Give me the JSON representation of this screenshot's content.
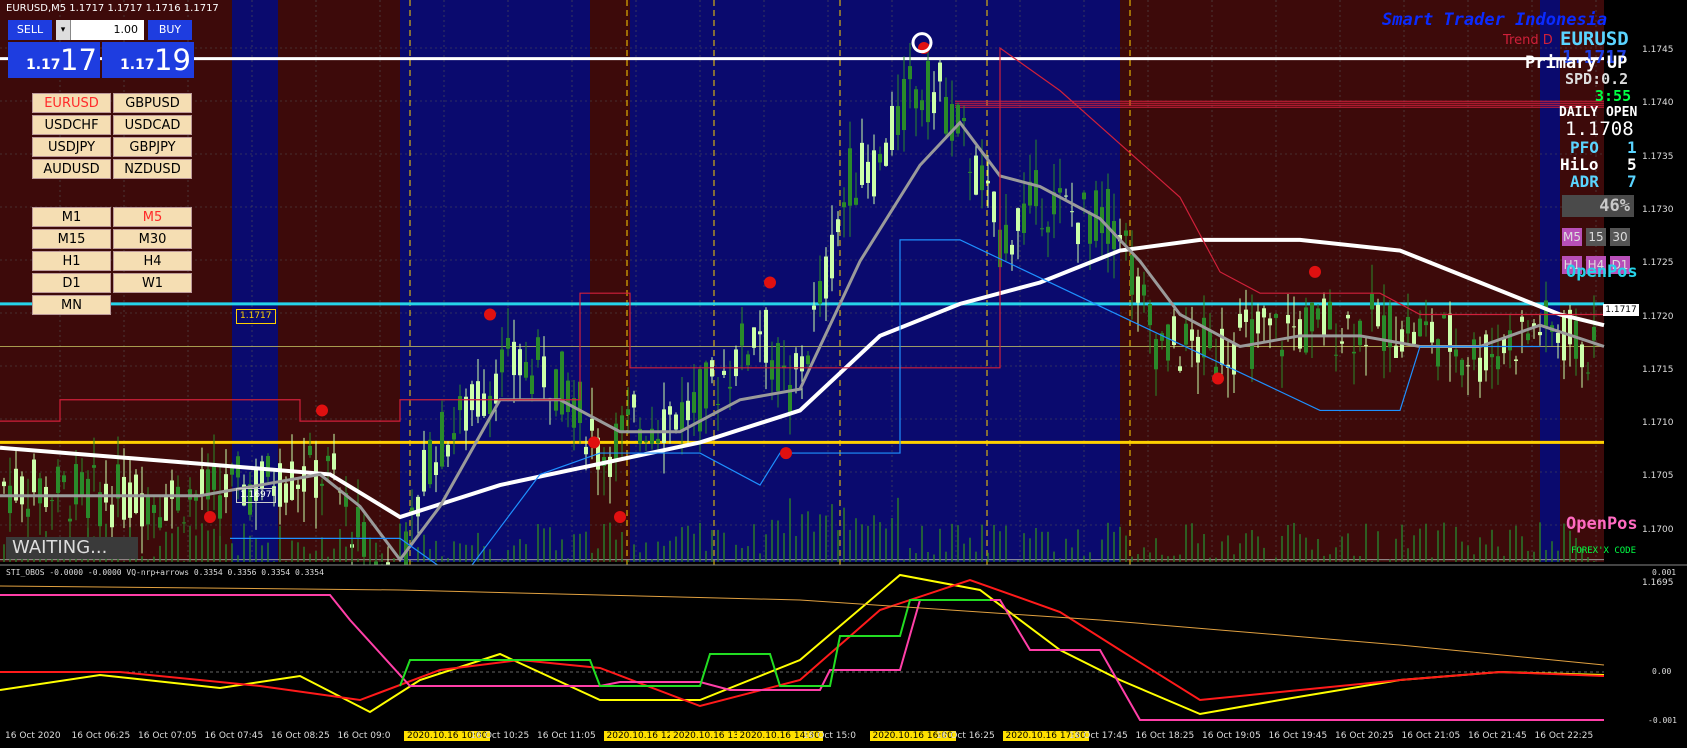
{
  "window": {
    "title": "EURUSD,M5  1.1717 1.1717 1.1716 1.1717"
  },
  "trade_panel": {
    "sell_label": "SELL",
    "buy_label": "BUY",
    "lot_value": "1.00",
    "bid_prefix": "1.17",
    "bid_big": "17",
    "ask_prefix": "1.17",
    "ask_big": "19"
  },
  "symbols": [
    "EURUSD",
    "GBPUSD",
    "USDCHF",
    "USDCAD",
    "USDJPY",
    "GBPJPY",
    "AUDUSD",
    "NZDUSD"
  ],
  "active_symbol": "EURUSD",
  "timeframes": [
    "M1",
    "M5",
    "M15",
    "M30",
    "H1",
    "H4",
    "D1",
    "W1",
    "MN"
  ],
  "active_timeframe": "M5",
  "status_text": "WAITING...",
  "brand": {
    "name": "Smart Trader Indonesia",
    "trend_text": "Trend D",
    "footer": "FOREX'X CODE"
  },
  "info": {
    "symbol": "EURUSD",
    "price": "1.1717",
    "primary": "Primary UP",
    "spread": "SPD:0.2",
    "countdown": "3:55",
    "daily_open_label": "DAILY OPEN",
    "daily_open_value": "1.1708",
    "pfo_label": "PFO",
    "pfo_value": "1",
    "hilo_label": "HiLo",
    "hilo_value": "5",
    "adr_label": "ADR",
    "adr_value": "7",
    "percent": "46%",
    "tf_row1": [
      "M5",
      "15",
      "30"
    ],
    "tf_row2": [
      "H1",
      "H4",
      "D1"
    ]
  },
  "labels": {
    "openpos_top": "OpenPos",
    "openpos_bottom": "OpenPos",
    "level_1717": "1.1717",
    "level_1697": "1.1697",
    "price_axis_current": "1.1717"
  },
  "indicator": {
    "title": "STI_OBOS -0.0000 -0.0000   VQ-nrp+arrows 0.3354 0.3356 0.3354 0.3354",
    "top": "0.001",
    "mid": "0.00",
    "bottom": "-0.001"
  },
  "price_axis": [
    "1.1745",
    "1.1740",
    "1.1735",
    "1.1730",
    "1.1725",
    "1.1720",
    "1.1715",
    "1.1710",
    "1.1705",
    "1.1700",
    "1.1695"
  ],
  "time_axis": [
    {
      "t": "16 Oct 2020",
      "hl": false
    },
    {
      "t": "16 Oct 06:25",
      "hl": false
    },
    {
      "t": "16 Oct 07:05",
      "hl": false
    },
    {
      "t": "16 Oct 07:45",
      "hl": false
    },
    {
      "t": "16 Oct 08:25",
      "hl": false
    },
    {
      "t": "16 Oct 09:0",
      "hl": false
    },
    {
      "t": "2020.10.16 10:00",
      "hl": true
    },
    {
      "t": "16 Oct 10:25",
      "hl": false
    },
    {
      "t": "16 Oct 11:05",
      "hl": false
    },
    {
      "t": "2020.10.16 12:15",
      "hl": true
    },
    {
      "t": "2020.10.16 13:10",
      "hl": true
    },
    {
      "t": "2020.10.16 14:30",
      "hl": true
    },
    {
      "t": "16 Oct 15:0",
      "hl": false
    },
    {
      "t": "2020.10.16 16:00",
      "hl": true
    },
    {
      "t": "16 Oct 16:25",
      "hl": false
    },
    {
      "t": "2020.10.16 17:30",
      "hl": true
    },
    {
      "t": "16 Oct 17:45",
      "hl": false
    },
    {
      "t": "16 Oct 18:25",
      "hl": false
    },
    {
      "t": "16 Oct 19:05",
      "hl": false
    },
    {
      "t": "16 Oct 19:45",
      "hl": false
    },
    {
      "t": "16 Oct 20:25",
      "hl": false
    },
    {
      "t": "16 Oct 21:05",
      "hl": false
    },
    {
      "t": "16 Oct 21:45",
      "hl": false
    },
    {
      "t": "16 Oct 22:25",
      "hl": false
    }
  ],
  "colors": {
    "bg": "#000000",
    "maroon": "#3d0a0a",
    "navy": "#0a0a6e",
    "bull": "#ccffaa",
    "bear": "#2a8a2a",
    "ema_white": "#ffffff",
    "ema_gray": "#9a9a9a",
    "cyan": "#26d4ea",
    "gold": "#ffd000",
    "pink": "#ff6ac1"
  }
}
